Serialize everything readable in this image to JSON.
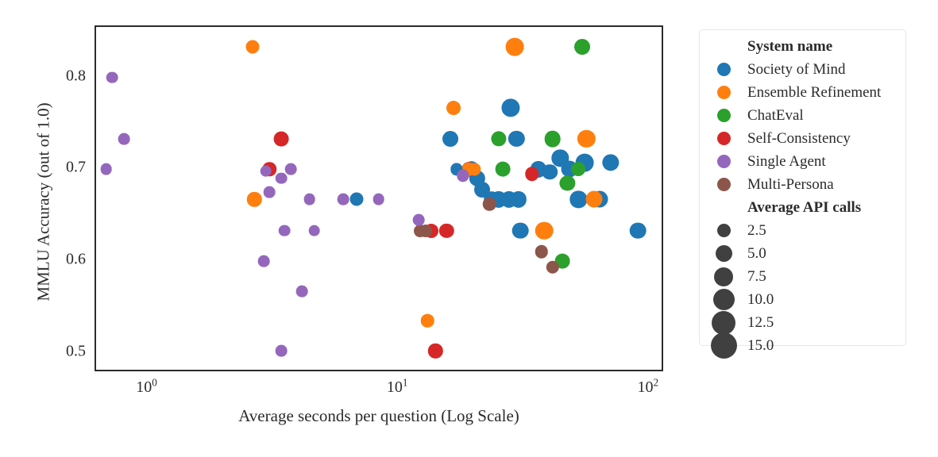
{
  "chart_data": {
    "type": "scatter",
    "title": "",
    "xlabel": "Average seconds per question (Log Scale)",
    "ylabel": "MMLU Accuracy (out of 1.0)",
    "xscale": "log",
    "yscale": "linear",
    "xlim": [
      0.62,
      115
    ],
    "ylim": [
      0.478,
      0.855
    ],
    "xticks": [
      "10^0",
      "10^1",
      "10^2"
    ],
    "xtick_values": [
      1,
      10,
      100
    ],
    "yticks": [
      "0.5",
      "0.6",
      "0.7",
      "0.8"
    ],
    "ytick_values": [
      0.5,
      0.6,
      0.7,
      0.8
    ],
    "grid": false,
    "legend_position": "right outside",
    "size_encoding": "Average API calls",
    "legend_title_hue": "System name",
    "legend_title_size": "Average API calls",
    "series": [
      {
        "name": "Society of Mind",
        "color": "#1f77b4",
        "points": [
          {
            "x": 6.8,
            "y": 0.667,
            "size": 4.0
          },
          {
            "x": 16.0,
            "y": 0.733,
            "size": 7.5
          },
          {
            "x": 17.0,
            "y": 0.7,
            "size": 2.5
          },
          {
            "x": 19.5,
            "y": 0.7,
            "size": 7.0
          },
          {
            "x": 20.5,
            "y": 0.69,
            "size": 8.0
          },
          {
            "x": 21.5,
            "y": 0.678,
            "size": 7.5
          },
          {
            "x": 23.5,
            "y": 0.667,
            "size": 7.0
          },
          {
            "x": 25.0,
            "y": 0.667,
            "size": 8.0
          },
          {
            "x": 27.5,
            "y": 0.667,
            "size": 8.0
          },
          {
            "x": 28.0,
            "y": 0.767,
            "size": 12.5
          },
          {
            "x": 29.5,
            "y": 0.733,
            "size": 8.0
          },
          {
            "x": 30.0,
            "y": 0.667,
            "size": 8.0
          },
          {
            "x": 30.5,
            "y": 0.633,
            "size": 8.5
          },
          {
            "x": 36.0,
            "y": 0.7,
            "size": 8.0
          },
          {
            "x": 40.0,
            "y": 0.697,
            "size": 7.0
          },
          {
            "x": 44.0,
            "y": 0.712,
            "size": 9.5
          },
          {
            "x": 48.0,
            "y": 0.7,
            "size": 9.0
          },
          {
            "x": 52.0,
            "y": 0.667,
            "size": 9.5
          },
          {
            "x": 55.0,
            "y": 0.707,
            "size": 12.0
          },
          {
            "x": 63.0,
            "y": 0.667,
            "size": 9.0
          },
          {
            "x": 70.0,
            "y": 0.707,
            "size": 9.5
          },
          {
            "x": 90.0,
            "y": 0.633,
            "size": 8.5
          }
        ]
      },
      {
        "name": "Ensemble Refinement",
        "color": "#ff7f0e",
        "points": [
          {
            "x": 2.6,
            "y": 0.833,
            "size": 4.0
          },
          {
            "x": 2.65,
            "y": 0.667,
            "size": 5.5
          },
          {
            "x": 13.0,
            "y": 0.535,
            "size": 3.5
          },
          {
            "x": 16.5,
            "y": 0.767,
            "size": 5.0
          },
          {
            "x": 19.0,
            "y": 0.7,
            "size": 3.5
          },
          {
            "x": 20.0,
            "y": 0.7,
            "size": 2.5
          },
          {
            "x": 29.0,
            "y": 0.833,
            "size": 12.0
          },
          {
            "x": 38.0,
            "y": 0.633,
            "size": 11.5
          },
          {
            "x": 56.0,
            "y": 0.733,
            "size": 11.0
          },
          {
            "x": 60.0,
            "y": 0.667,
            "size": 9.0
          }
        ]
      },
      {
        "name": "ChatEval",
        "color": "#2ca02c",
        "points": [
          {
            "x": 25.0,
            "y": 0.733,
            "size": 6.5
          },
          {
            "x": 26.0,
            "y": 0.7,
            "size": 6.0
          },
          {
            "x": 41.0,
            "y": 0.733,
            "size": 8.5
          },
          {
            "x": 45.0,
            "y": 0.6,
            "size": 6.0
          },
          {
            "x": 47.0,
            "y": 0.685,
            "size": 6.5
          },
          {
            "x": 52.0,
            "y": 0.7,
            "size": 5.0
          },
          {
            "x": 54.0,
            "y": 0.833,
            "size": 7.5
          }
        ]
      },
      {
        "name": "Self-Consistency",
        "color": "#d62728",
        "points": [
          {
            "x": 3.4,
            "y": 0.733,
            "size": 6.0
          },
          {
            "x": 3.05,
            "y": 0.7,
            "size": 4.5
          },
          {
            "x": 13.5,
            "y": 0.633,
            "size": 5.0
          },
          {
            "x": 14.0,
            "y": 0.502,
            "size": 5.5
          },
          {
            "x": 15.5,
            "y": 0.633,
            "size": 5.5
          },
          {
            "x": 19.0,
            "y": 0.7,
            "size": 4.5
          },
          {
            "x": 34.0,
            "y": 0.695,
            "size": 4.5
          }
        ]
      },
      {
        "name": "Single Agent",
        "color": "#9467bd",
        "points": [
          {
            "x": 0.72,
            "y": 0.8,
            "size": 2.0
          },
          {
            "x": 0.8,
            "y": 0.733,
            "size": 2.0
          },
          {
            "x": 0.68,
            "y": 0.7,
            "size": 2.0
          },
          {
            "x": 2.95,
            "y": 0.698,
            "size": 2.0
          },
          {
            "x": 3.05,
            "y": 0.675,
            "size": 2.0
          },
          {
            "x": 3.4,
            "y": 0.69,
            "size": 2.0
          },
          {
            "x": 3.7,
            "y": 0.7,
            "size": 2.0
          },
          {
            "x": 2.9,
            "y": 0.6,
            "size": 2.0
          },
          {
            "x": 3.5,
            "y": 0.633,
            "size": 2.0
          },
          {
            "x": 4.4,
            "y": 0.667,
            "size": 2.0
          },
          {
            "x": 4.1,
            "y": 0.567,
            "size": 2.0
          },
          {
            "x": 4.6,
            "y": 0.633,
            "size": 2.0
          },
          {
            "x": 3.4,
            "y": 0.502,
            "size": 2.0
          },
          {
            "x": 6.0,
            "y": 0.667,
            "size": 2.0
          },
          {
            "x": 8.3,
            "y": 0.667,
            "size": 2.0
          },
          {
            "x": 12.0,
            "y": 0.645,
            "size": 2.0
          },
          {
            "x": 18.0,
            "y": 0.693,
            "size": 2.5
          }
        ]
      },
      {
        "name": "Multi-Persona",
        "color": "#8c564b",
        "points": [
          {
            "x": 12.2,
            "y": 0.633,
            "size": 3.0
          },
          {
            "x": 12.8,
            "y": 0.633,
            "size": 3.0
          },
          {
            "x": 23.0,
            "y": 0.662,
            "size": 3.5
          },
          {
            "x": 37.0,
            "y": 0.61,
            "size": 3.5
          },
          {
            "x": 41.0,
            "y": 0.593,
            "size": 3.5
          }
        ]
      }
    ]
  },
  "legend": {
    "hue_title": "System name",
    "size_title": "Average API calls",
    "hue_entries": [
      {
        "label": "Society of Mind",
        "color": "#1f77b4"
      },
      {
        "label": "Ensemble Refinement",
        "color": "#ff7f0e"
      },
      {
        "label": "ChatEval",
        "color": "#2ca02c"
      },
      {
        "label": "Self-Consistency",
        "color": "#d62728"
      },
      {
        "label": "Single Agent",
        "color": "#9467bd"
      },
      {
        "label": "Multi-Persona",
        "color": "#8c564b"
      }
    ],
    "size_entries": [
      {
        "label": "2.5",
        "diameter": 17
      },
      {
        "label": "5.0",
        "diameter": 21
      },
      {
        "label": "7.5",
        "diameter": 24
      },
      {
        "label": "10.0",
        "diameter": 27
      },
      {
        "label": "12.5",
        "diameter": 30
      },
      {
        "label": "15.0",
        "diameter": 33
      }
    ],
    "size_swatch_color": "#404040"
  },
  "axes": {
    "xlabel": "Average seconds per question (Log Scale)",
    "ylabel": "MMLU Accuracy (out of 1.0)",
    "yticks": [
      "0.5",
      "0.6",
      "0.7",
      "0.8"
    ],
    "xticks": [
      {
        "base": "10",
        "exp": "0"
      },
      {
        "base": "10",
        "exp": "1"
      },
      {
        "base": "10",
        "exp": "2"
      }
    ]
  }
}
